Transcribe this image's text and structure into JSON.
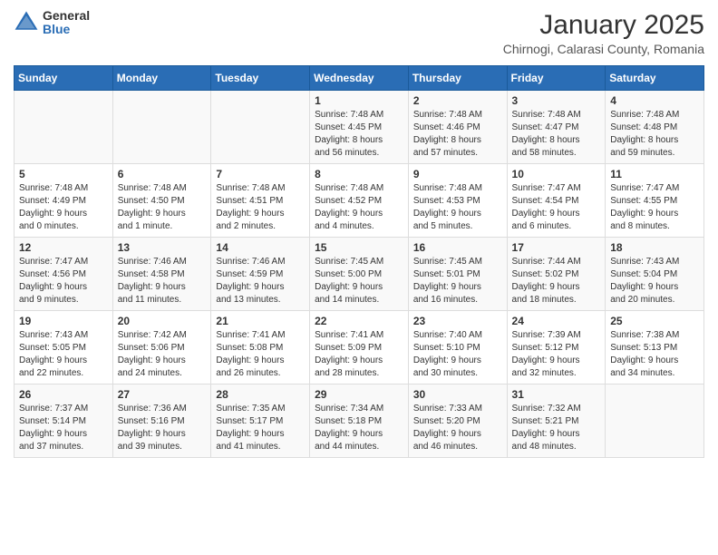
{
  "header": {
    "logo_general": "General",
    "logo_blue": "Blue",
    "main_title": "January 2025",
    "subtitle": "Chirnogi, Calarasi County, Romania"
  },
  "days_of_week": [
    "Sunday",
    "Monday",
    "Tuesday",
    "Wednesday",
    "Thursday",
    "Friday",
    "Saturday"
  ],
  "weeks": [
    [
      {
        "num": "",
        "info": ""
      },
      {
        "num": "",
        "info": ""
      },
      {
        "num": "",
        "info": ""
      },
      {
        "num": "1",
        "info": "Sunrise: 7:48 AM\nSunset: 4:45 PM\nDaylight: 8 hours\nand 56 minutes."
      },
      {
        "num": "2",
        "info": "Sunrise: 7:48 AM\nSunset: 4:46 PM\nDaylight: 8 hours\nand 57 minutes."
      },
      {
        "num": "3",
        "info": "Sunrise: 7:48 AM\nSunset: 4:47 PM\nDaylight: 8 hours\nand 58 minutes."
      },
      {
        "num": "4",
        "info": "Sunrise: 7:48 AM\nSunset: 4:48 PM\nDaylight: 8 hours\nand 59 minutes."
      }
    ],
    [
      {
        "num": "5",
        "info": "Sunrise: 7:48 AM\nSunset: 4:49 PM\nDaylight: 9 hours\nand 0 minutes."
      },
      {
        "num": "6",
        "info": "Sunrise: 7:48 AM\nSunset: 4:50 PM\nDaylight: 9 hours\nand 1 minute."
      },
      {
        "num": "7",
        "info": "Sunrise: 7:48 AM\nSunset: 4:51 PM\nDaylight: 9 hours\nand 2 minutes."
      },
      {
        "num": "8",
        "info": "Sunrise: 7:48 AM\nSunset: 4:52 PM\nDaylight: 9 hours\nand 4 minutes."
      },
      {
        "num": "9",
        "info": "Sunrise: 7:48 AM\nSunset: 4:53 PM\nDaylight: 9 hours\nand 5 minutes."
      },
      {
        "num": "10",
        "info": "Sunrise: 7:47 AM\nSunset: 4:54 PM\nDaylight: 9 hours\nand 6 minutes."
      },
      {
        "num": "11",
        "info": "Sunrise: 7:47 AM\nSunset: 4:55 PM\nDaylight: 9 hours\nand 8 minutes."
      }
    ],
    [
      {
        "num": "12",
        "info": "Sunrise: 7:47 AM\nSunset: 4:56 PM\nDaylight: 9 hours\nand 9 minutes."
      },
      {
        "num": "13",
        "info": "Sunrise: 7:46 AM\nSunset: 4:58 PM\nDaylight: 9 hours\nand 11 minutes."
      },
      {
        "num": "14",
        "info": "Sunrise: 7:46 AM\nSunset: 4:59 PM\nDaylight: 9 hours\nand 13 minutes."
      },
      {
        "num": "15",
        "info": "Sunrise: 7:45 AM\nSunset: 5:00 PM\nDaylight: 9 hours\nand 14 minutes."
      },
      {
        "num": "16",
        "info": "Sunrise: 7:45 AM\nSunset: 5:01 PM\nDaylight: 9 hours\nand 16 minutes."
      },
      {
        "num": "17",
        "info": "Sunrise: 7:44 AM\nSunset: 5:02 PM\nDaylight: 9 hours\nand 18 minutes."
      },
      {
        "num": "18",
        "info": "Sunrise: 7:43 AM\nSunset: 5:04 PM\nDaylight: 9 hours\nand 20 minutes."
      }
    ],
    [
      {
        "num": "19",
        "info": "Sunrise: 7:43 AM\nSunset: 5:05 PM\nDaylight: 9 hours\nand 22 minutes."
      },
      {
        "num": "20",
        "info": "Sunrise: 7:42 AM\nSunset: 5:06 PM\nDaylight: 9 hours\nand 24 minutes."
      },
      {
        "num": "21",
        "info": "Sunrise: 7:41 AM\nSunset: 5:08 PM\nDaylight: 9 hours\nand 26 minutes."
      },
      {
        "num": "22",
        "info": "Sunrise: 7:41 AM\nSunset: 5:09 PM\nDaylight: 9 hours\nand 28 minutes."
      },
      {
        "num": "23",
        "info": "Sunrise: 7:40 AM\nSunset: 5:10 PM\nDaylight: 9 hours\nand 30 minutes."
      },
      {
        "num": "24",
        "info": "Sunrise: 7:39 AM\nSunset: 5:12 PM\nDaylight: 9 hours\nand 32 minutes."
      },
      {
        "num": "25",
        "info": "Sunrise: 7:38 AM\nSunset: 5:13 PM\nDaylight: 9 hours\nand 34 minutes."
      }
    ],
    [
      {
        "num": "26",
        "info": "Sunrise: 7:37 AM\nSunset: 5:14 PM\nDaylight: 9 hours\nand 37 minutes."
      },
      {
        "num": "27",
        "info": "Sunrise: 7:36 AM\nSunset: 5:16 PM\nDaylight: 9 hours\nand 39 minutes."
      },
      {
        "num": "28",
        "info": "Sunrise: 7:35 AM\nSunset: 5:17 PM\nDaylight: 9 hours\nand 41 minutes."
      },
      {
        "num": "29",
        "info": "Sunrise: 7:34 AM\nSunset: 5:18 PM\nDaylight: 9 hours\nand 44 minutes."
      },
      {
        "num": "30",
        "info": "Sunrise: 7:33 AM\nSunset: 5:20 PM\nDaylight: 9 hours\nand 46 minutes."
      },
      {
        "num": "31",
        "info": "Sunrise: 7:32 AM\nSunset: 5:21 PM\nDaylight: 9 hours\nand 48 minutes."
      },
      {
        "num": "",
        "info": ""
      }
    ]
  ]
}
